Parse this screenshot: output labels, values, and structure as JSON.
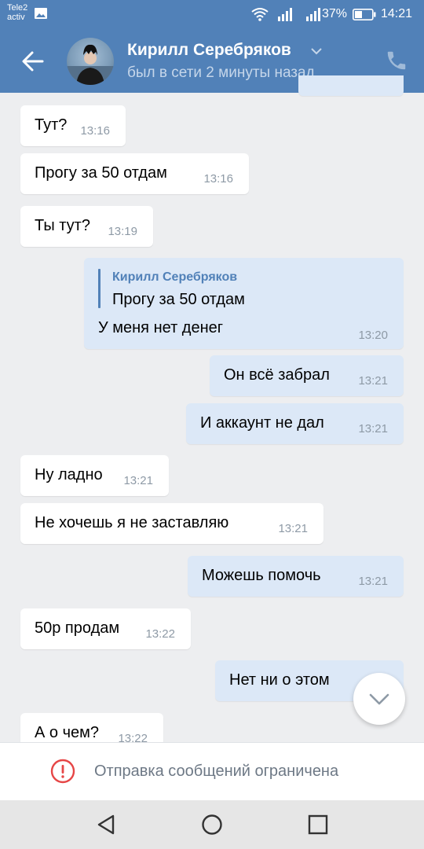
{
  "status_bar": {
    "carrier_line1": "Tele2",
    "carrier_line2": "activ",
    "battery_percent": "37%",
    "time": "14:21"
  },
  "header": {
    "contact_name": "Кирилл Серебряков",
    "contact_status": "был в сети 2 минуты назад"
  },
  "messages": [
    {
      "direction": "in",
      "text": "Тут?",
      "time": "13:16"
    },
    {
      "direction": "in",
      "text": "Прогу за 50 отдам",
      "time": "13:16"
    },
    {
      "direction": "in",
      "text": "Ты тут?",
      "time": "13:19"
    },
    {
      "direction": "out",
      "quote_author": "Кирилл Серебряков",
      "quote_text": "Прогу за 50 отдам",
      "text": "У меня нет денег",
      "time": "13:20"
    },
    {
      "direction": "out",
      "text": "Он всё забрал",
      "time": "13:21"
    },
    {
      "direction": "out",
      "text": "И аккаунт не дал",
      "time": "13:21"
    },
    {
      "direction": "in",
      "text": "Ну ладно",
      "time": "13:21"
    },
    {
      "direction": "in",
      "text": "Не хочешь я не заставляю",
      "time": "13:21"
    },
    {
      "direction": "out",
      "text": "Можешь помочь",
      "time": "13:21"
    },
    {
      "direction": "in",
      "text": "50р продам",
      "time": "13:22"
    },
    {
      "direction": "out",
      "text": "Нет ни о этом",
      "time": ""
    },
    {
      "direction": "in",
      "text": "А о чем?",
      "time": "13:22"
    }
  ],
  "restriction": {
    "text": "Отправка сообщений ограничена"
  },
  "icons": {
    "back": "arrow-left-icon",
    "call": "phone-icon",
    "dropdown": "chevron-down-icon",
    "scroll_down": "chevron-down-icon",
    "warning": "exclamation-circle-icon"
  },
  "colors": {
    "header": "#5181b8",
    "incoming_bubble": "#ffffff",
    "outgoing_bubble": "#dce8f7",
    "background": "#edeef0",
    "warning": "#e64646"
  }
}
